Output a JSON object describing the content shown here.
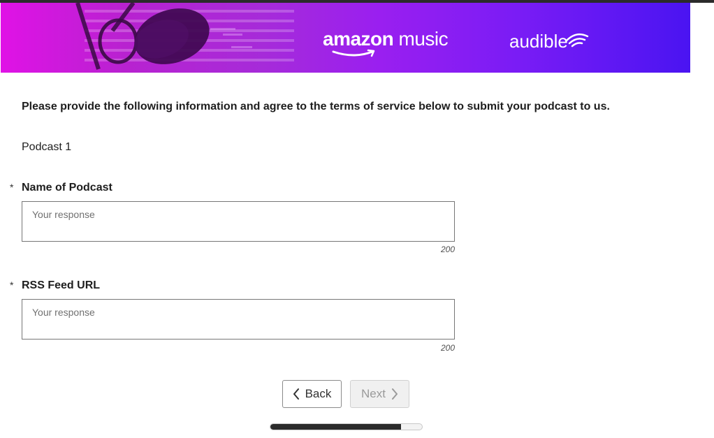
{
  "banner": {
    "amazon_music_bold": "amazon",
    "amazon_music_light": "music",
    "audible": "audible"
  },
  "form": {
    "intro": "Please provide the following information and agree to the terms of service below to submit your podcast to us.",
    "section_title": "Podcast 1",
    "questions": [
      {
        "required_marker": "*",
        "label": "Name of Podcast",
        "placeholder": "Your response",
        "value": "",
        "char_limit": "200"
      },
      {
        "required_marker": "*",
        "label": "RSS Feed URL",
        "placeholder": "Your response",
        "value": "",
        "char_limit": "200"
      }
    ]
  },
  "navigation": {
    "back_label": "Back",
    "next_label": "Next",
    "next_disabled": true
  },
  "progress": {
    "fraction": 0.86
  },
  "colors": {
    "banner_gradient_start": "#e012e6",
    "banner_gradient_end": "#4a14f2",
    "progress_fill": "#2b2b2b"
  },
  "icons": {
    "back": "chevron-left-icon",
    "next": "chevron-right-icon"
  }
}
